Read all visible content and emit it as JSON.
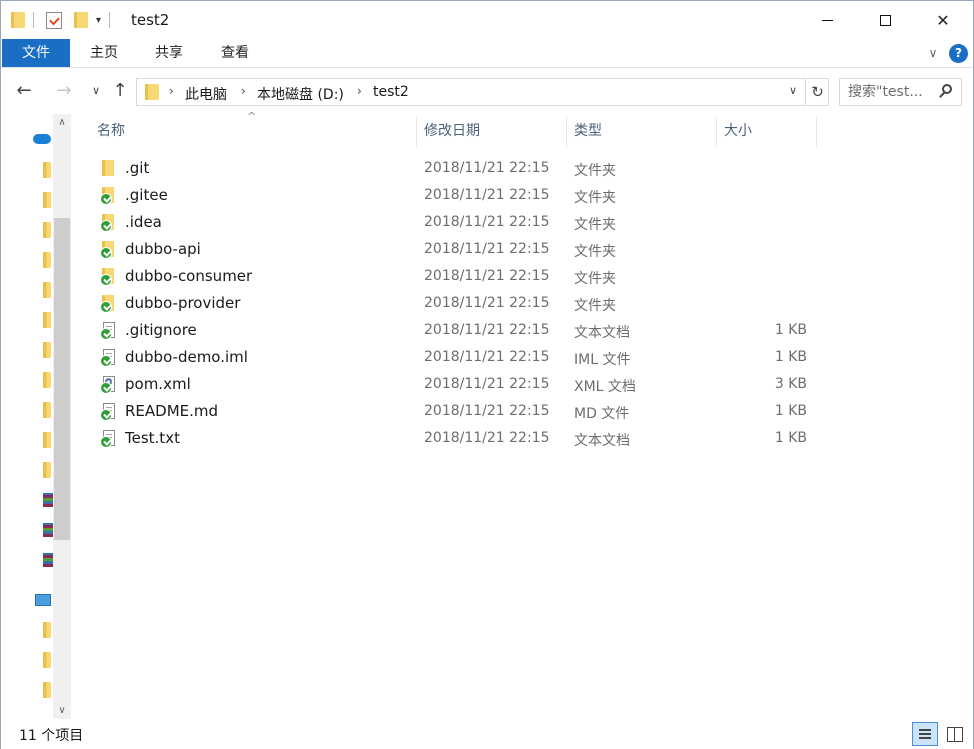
{
  "window": {
    "title": "test2"
  },
  "ribbon": {
    "tabs": [
      {
        "label": "文件"
      },
      {
        "label": "主页"
      },
      {
        "label": "共享"
      },
      {
        "label": "查看"
      }
    ],
    "help": "?"
  },
  "address": {
    "crumbs": [
      "此电脑",
      "本地磁盘 (D:)",
      "test2"
    ]
  },
  "search": {
    "placeholder": "搜索\"test..."
  },
  "columns": {
    "name": "名称",
    "date": "修改日期",
    "type": "类型",
    "size": "大小"
  },
  "files": [
    {
      "name": ".git",
      "date": "2018/11/21 22:15",
      "type": "文件夹",
      "size": "",
      "icon": "folder-icon"
    },
    {
      "name": ".gitee",
      "date": "2018/11/21 22:15",
      "type": "文件夹",
      "size": "",
      "icon": "folder-synced-icon"
    },
    {
      "name": ".idea",
      "date": "2018/11/21 22:15",
      "type": "文件夹",
      "size": "",
      "icon": "folder-synced-icon"
    },
    {
      "name": "dubbo-api",
      "date": "2018/11/21 22:15",
      "type": "文件夹",
      "size": "",
      "icon": "folder-synced-icon"
    },
    {
      "name": "dubbo-consumer",
      "date": "2018/11/21 22:15",
      "type": "文件夹",
      "size": "",
      "icon": "folder-synced-icon"
    },
    {
      "name": "dubbo-provider",
      "date": "2018/11/21 22:15",
      "type": "文件夹",
      "size": "",
      "icon": "folder-synced-icon"
    },
    {
      "name": ".gitignore",
      "date": "2018/11/21 22:15",
      "type": "文本文档",
      "size": "1 KB",
      "icon": "document-synced-icon"
    },
    {
      "name": "dubbo-demo.iml",
      "date": "2018/11/21 22:15",
      "type": "IML 文件",
      "size": "1 KB",
      "icon": "document-synced-icon"
    },
    {
      "name": "pom.xml",
      "date": "2018/11/21 22:15",
      "type": "XML 文档",
      "size": "3 KB",
      "icon": "xml-synced-icon"
    },
    {
      "name": "README.md",
      "date": "2018/11/21 22:15",
      "type": "MD 文件",
      "size": "1 KB",
      "icon": "document-synced-icon"
    },
    {
      "name": "Test.txt",
      "date": "2018/11/21 22:15",
      "type": "文本文档",
      "size": "1 KB",
      "icon": "document-synced-icon"
    }
  ],
  "status": {
    "count": "11 个项目"
  },
  "colors": {
    "accent": "#1a6fc4",
    "synced": "#2f9e36",
    "folder": "#f8d775"
  }
}
